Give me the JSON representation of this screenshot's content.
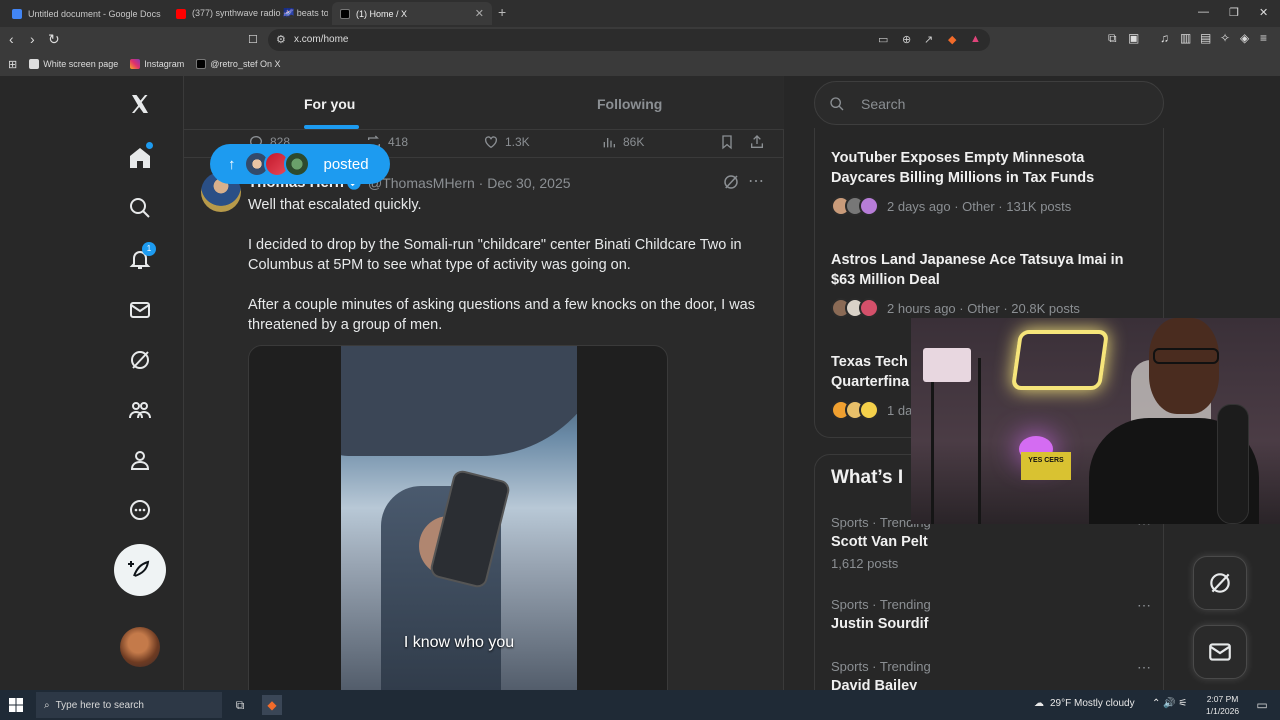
{
  "browser": {
    "tabs": [
      {
        "title": "Untitled document - Google Docs",
        "color": "#4285f4"
      },
      {
        "title": "(377) synthwave radio 🌌 beats to",
        "color": "#ff0000"
      },
      {
        "title": "(1) Home / X",
        "color": "#000000"
      }
    ],
    "url": "x.com/home",
    "bookmarks": [
      {
        "label": "White screen page"
      },
      {
        "label": "Instagram"
      },
      {
        "label": "@retro_stef On X"
      }
    ]
  },
  "timeline": {
    "tab_for_you": "For you",
    "tab_following": "Following",
    "prev_actions": {
      "replies": "828",
      "reposts": "418",
      "likes": "1.3K",
      "views": "86K"
    },
    "posted_pill": "posted",
    "tweet": {
      "name": "Thomas Hern",
      "handle": "@ThomasMHern · Dec 30, 2025",
      "text": "Well that escalated quickly.\n\nI decided to drop by the Somali-run \"childcare\" center Binati Childcare Two in Columbus at 5PM to see what type of activity was going on.\n\nAfter a couple minutes of asking questions and a few knocks on the door, I was threatened by a group of men.",
      "video_caption": "I know who you"
    }
  },
  "leftnav": {
    "notification_count": "1"
  },
  "right": {
    "search_placeholder": "Search",
    "news": [
      {
        "title": "YouTuber Exposes Empty Minnesota Daycares Billing Millions in Tax Funds",
        "meta": "2 days ago · Other · 131K posts"
      },
      {
        "title": "Astros Land Japanese Ace Tatsuya Imai in $63 Million Deal",
        "meta": "2 hours ago · Other · 20.8K posts"
      },
      {
        "title": "Texas Tech I",
        "title2": "Quarterfina",
        "meta": "1 da"
      }
    ],
    "trends_header": "What’s I",
    "trends": [
      {
        "context": "Sports · Trending",
        "name": "Scott Van Pelt",
        "count": "1,612 posts"
      },
      {
        "context": "Sports · Trending",
        "name": "Justin Sourdif",
        "count": ""
      },
      {
        "context": "Sports · Trending",
        "name": "David Bailey",
        "count": ""
      }
    ]
  },
  "webcam": {
    "sign_text": "YES CERS"
  },
  "taskbar": {
    "search_placeholder": "Type here to search",
    "weather": "29°F  Mostly cloudy",
    "time": "2:07 PM",
    "date": "1/1/2026"
  }
}
